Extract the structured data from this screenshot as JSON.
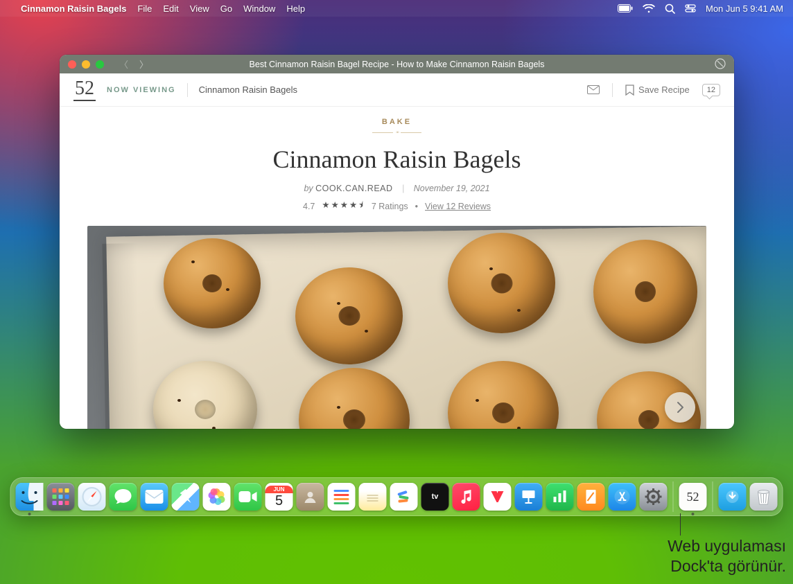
{
  "menubar": {
    "appName": "Cinnamon Raisin Bagels",
    "items": [
      "File",
      "Edit",
      "View",
      "Go",
      "Window",
      "Help"
    ],
    "clock": "Mon Jun 5  9:41 AM"
  },
  "window": {
    "title": "Best Cinnamon Raisin Bagel Recipe - How to Make Cinnamon Raisin Bagels",
    "logo": "52",
    "nowViewing": "NOW VIEWING",
    "breadcrumb": "Cinnamon Raisin Bagels",
    "saveRecipe": "Save Recipe",
    "commentCount": "12",
    "kicker": "BAKE",
    "recipeTitle": "Cinnamon Raisin Bagels",
    "byLabel": "by",
    "author": "COOK.CAN.READ",
    "date": "November 19, 2021",
    "ratingValue": "4.7",
    "stars": "★★★★⯨",
    "ratingCount": "7 Ratings",
    "reviewsLink": "View 12 Reviews"
  },
  "dock": {
    "calMonth": "JUN",
    "calDay": "5",
    "app52": "52"
  },
  "callout": {
    "line1": "Web uygulaması",
    "line2": "Dock'ta görünür."
  }
}
